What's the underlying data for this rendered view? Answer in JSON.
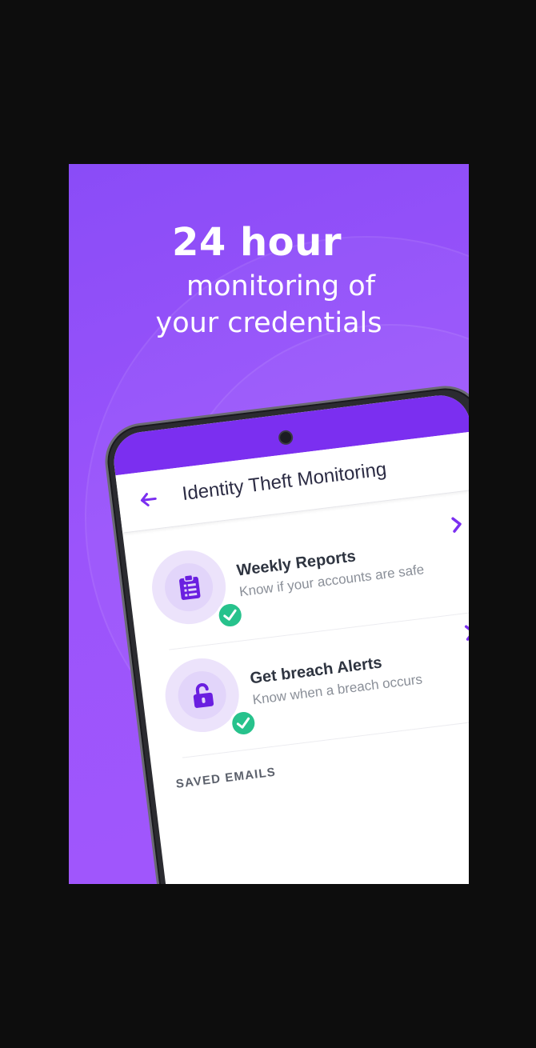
{
  "headline": {
    "line1": "24 hour",
    "line2": "monitoring of",
    "line3": "your credentials"
  },
  "app": {
    "title": "Identity Theft Monitoring",
    "rows": [
      {
        "title": "Weekly Reports",
        "subtitle": "Know if your accounts are safe",
        "icon": "clipboard-icon",
        "status": "checked"
      },
      {
        "title": "Get breach Alerts",
        "subtitle": "Know when a breach occurs",
        "icon": "unlock-icon",
        "status": "checked"
      }
    ],
    "section_label": "SAVED EMAILS"
  },
  "colors": {
    "background": "#0d0d0d",
    "promo_purple": "#9b54fb",
    "accent": "#7b2ff0",
    "check_green": "#27c28c"
  }
}
